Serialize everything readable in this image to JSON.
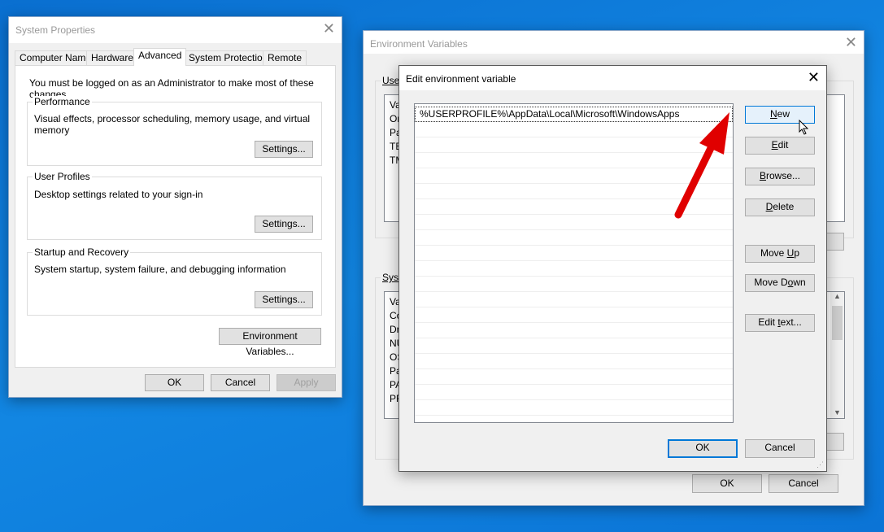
{
  "system_properties": {
    "title": "System Properties",
    "tabs": [
      "Computer Name",
      "Hardware",
      "Advanced",
      "System Protection",
      "Remote"
    ],
    "selected_tab": "Advanced",
    "admin_note": "You must be logged on as an Administrator to make most of these changes.",
    "groups": [
      {
        "label": "Performance",
        "desc": "Visual effects, processor scheduling, memory usage, and virtual memory",
        "button": "Settings..."
      },
      {
        "label": "User Profiles",
        "desc": "Desktop settings related to your sign-in",
        "button": "Settings..."
      },
      {
        "label": "Startup and Recovery",
        "desc": "System startup, system failure, and debugging information",
        "button": "Settings..."
      }
    ],
    "env_button": "Environment Variables...",
    "ok": "OK",
    "cancel": "Cancel",
    "apply": "Apply"
  },
  "env_vars": {
    "title": "Environment Variables",
    "user_label": "User",
    "system_label": "Syste",
    "user_rows": [
      "Va",
      "Or",
      "Pa",
      "TE",
      "TM"
    ],
    "system_rows": [
      "Va",
      "Co",
      "Dr",
      "NU",
      "OS",
      "Pa",
      "PA",
      "PR"
    ],
    "ok": "OK",
    "cancel": "Cancel"
  },
  "edit_dialog": {
    "title": "Edit environment variable",
    "entries": [
      "%USERPROFILE%\\AppData\\Local\\Microsoft\\WindowsApps"
    ],
    "buttons": {
      "new": "New",
      "edit": "Edit",
      "browse": "Browse...",
      "delete": "Delete",
      "move_up": "Move Up",
      "move_down": "Move Down",
      "edit_text": "Edit text..."
    },
    "ok": "OK",
    "cancel": "Cancel"
  },
  "colors": {
    "desktop": "#0b78d7",
    "accent": "#0078d7",
    "arrow": "#e00000"
  }
}
